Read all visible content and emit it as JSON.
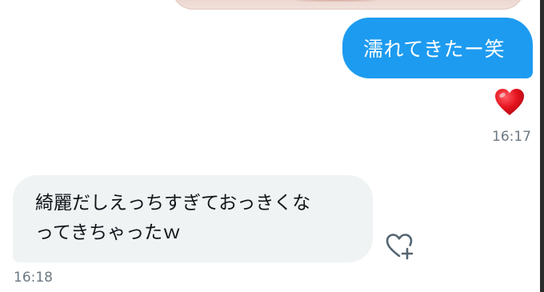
{
  "conversation": {
    "messages": [
      {
        "direction": "outgoing",
        "text": "濡れてきたー笑",
        "reaction_icon": "red-heart-icon",
        "time": "16:17"
      },
      {
        "direction": "incoming",
        "lines": [
          "綺麗だしえっちすぎておっきくな",
          "ってきちゃったｗ"
        ],
        "action_icon": "heart-plus-icon",
        "time": "16:18"
      }
    ]
  },
  "colors": {
    "outgoing_bubble": "#1d9bf0",
    "incoming_bubble": "#eff3f4",
    "timestamp": "#6c7882",
    "heart": "#e4121d"
  }
}
